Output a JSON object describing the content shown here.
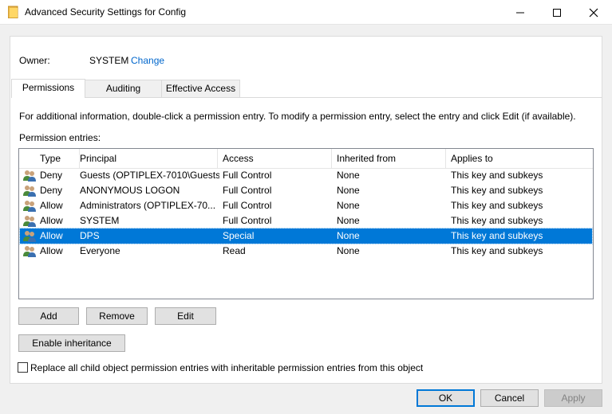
{
  "window": {
    "title": "Advanced Security Settings for Config"
  },
  "owner": {
    "label": "Owner:",
    "value": "SYSTEM",
    "change_link": "Change"
  },
  "tabs": [
    {
      "label": "Permissions",
      "active": true
    },
    {
      "label": "Auditing",
      "active": false
    },
    {
      "label": "Effective Access",
      "active": false
    }
  ],
  "info_text": "For additional information, double-click a permission entry. To modify a permission entry, select the entry and click Edit (if available).",
  "entries_label": "Permission entries:",
  "columns": [
    "Type",
    "Principal",
    "Access",
    "Inherited from",
    "Applies to"
  ],
  "rows": [
    {
      "type": "Deny",
      "principal": "Guests (OPTIPLEX-7010\\Guests)",
      "access": "Full Control",
      "inherited": "None",
      "applies": "This key and subkeys",
      "selected": false
    },
    {
      "type": "Deny",
      "principal": "ANONYMOUS LOGON",
      "access": "Full Control",
      "inherited": "None",
      "applies": "This key and subkeys",
      "selected": false
    },
    {
      "type": "Allow",
      "principal": "Administrators (OPTIPLEX-70...",
      "access": "Full Control",
      "inherited": "None",
      "applies": "This key and subkeys",
      "selected": false
    },
    {
      "type": "Allow",
      "principal": "SYSTEM",
      "access": "Full Control",
      "inherited": "None",
      "applies": "This key and subkeys",
      "selected": false
    },
    {
      "type": "Allow",
      "principal": "DPS",
      "access": "Special",
      "inherited": "None",
      "applies": "This key and subkeys",
      "selected": true
    },
    {
      "type": "Allow",
      "principal": "Everyone",
      "access": "Read",
      "inherited": "None",
      "applies": "This key and subkeys",
      "selected": false
    }
  ],
  "buttons": {
    "add": "Add",
    "remove": "Remove",
    "edit": "Edit",
    "enable_inheritance": "Enable inheritance",
    "ok": "OK",
    "cancel": "Cancel",
    "apply": "Apply"
  },
  "replace_checkbox": {
    "label": "Replace all child object permission entries with inheritable permission entries from this object",
    "checked": false
  },
  "colors": {
    "selection": "#0078d7",
    "link": "#0066cc",
    "button_bg": "#e1e1e1"
  }
}
